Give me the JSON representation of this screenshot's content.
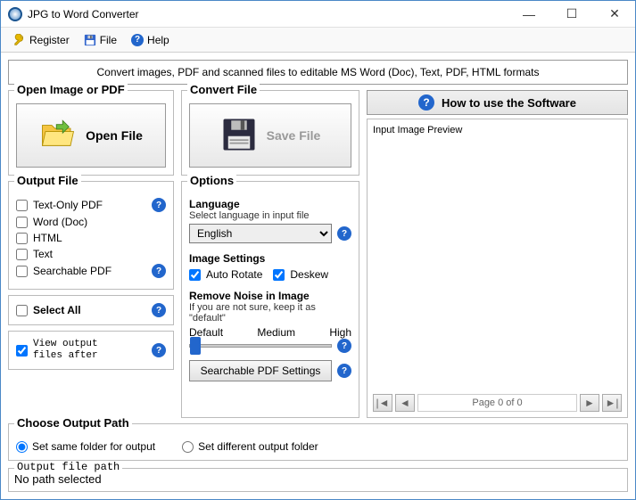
{
  "titlebar": {
    "title": "JPG to Word Converter"
  },
  "menu": {
    "register": "Register",
    "file": "File",
    "help": "Help"
  },
  "banner": "Convert images, PDF and scanned files to editable MS Word (Doc), Text, PDF, HTML formats",
  "open_section": {
    "title": "Open Image or PDF",
    "button": "Open File"
  },
  "convert_section": {
    "title": "Convert File",
    "button": "Save File"
  },
  "output_file": {
    "title": "Output File",
    "o1": "Text-Only PDF",
    "o2": "Word (Doc)",
    "o3": "HTML",
    "o4": "Text",
    "o5": "Searchable PDF",
    "select_all": "Select All"
  },
  "options": {
    "title": "Options",
    "lang_title": "Language",
    "lang_desc": "Select language in input file",
    "lang_value": "English",
    "img_title": "Image Settings",
    "auto_rotate": "Auto Rotate",
    "deskew": "Deskew",
    "noise_title": "Remove Noise in Image",
    "noise_desc": "If you are not sure, keep it as \"default\"",
    "slider_default": "Default",
    "slider_medium": "Medium",
    "slider_high": "High",
    "pdf_settings": "Searchable PDF Settings"
  },
  "view_after": "View output\nfiles after",
  "choose_path": {
    "title": "Choose Output Path",
    "same": "Set same folder for output",
    "diff": "Set different output folder"
  },
  "output_path": {
    "title": "Output file path",
    "value": "No path selected"
  },
  "howto": {
    "title": "How to use the Software"
  },
  "preview": {
    "label": "Input Image Preview",
    "pager": "Page 0 of 0"
  }
}
